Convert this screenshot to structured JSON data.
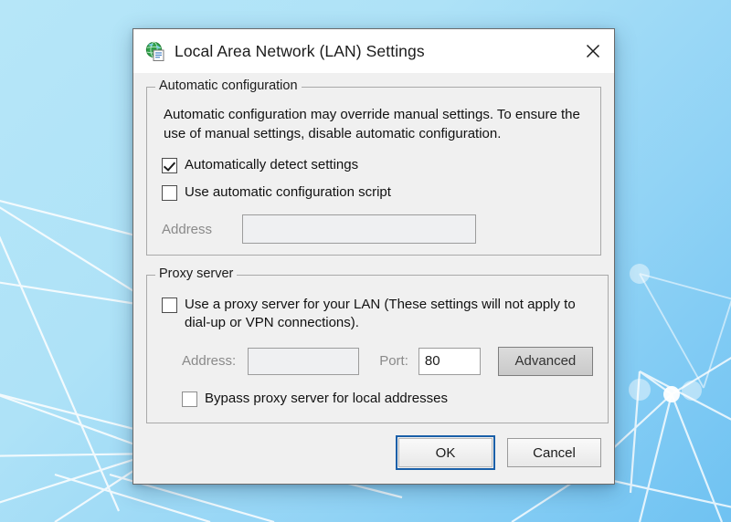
{
  "window": {
    "title": "Local Area Network (LAN) Settings",
    "icon": "globe-document-icon",
    "close_label": "close-icon"
  },
  "automatic_configuration": {
    "group_title": "Automatic configuration",
    "description": "Automatic configuration may override manual settings.  To ensure the use of manual settings, disable automatic configuration.",
    "auto_detect": {
      "label": "Automatically detect settings",
      "checked": true
    },
    "use_script": {
      "label": "Use automatic configuration script",
      "checked": false
    },
    "address": {
      "label": "Address",
      "value": "",
      "placeholder": "",
      "enabled": false
    }
  },
  "proxy_server": {
    "group_title": "Proxy server",
    "use_proxy": {
      "label": "Use a proxy server for your LAN (These settings will not apply to dial-up or VPN connections).",
      "checked": false
    },
    "address": {
      "label": "Address:",
      "value": "",
      "placeholder": "",
      "enabled": false
    },
    "port": {
      "label": "Port:",
      "value": "80",
      "placeholder": "",
      "enabled": false
    },
    "advanced_button": {
      "label": "Advanced",
      "enabled": false
    },
    "bypass": {
      "label": "Bypass proxy server for local addresses",
      "checked": false
    }
  },
  "footer": {
    "ok_label": "OK",
    "cancel_label": "Cancel"
  },
  "colors": {
    "desktop_blue": "#8fd2f5",
    "dialog_face": "#f0f0f0",
    "titlebar": "#ffffff",
    "group_border": "#a9a9a9",
    "focus_blue": "#1a5fa8",
    "disabled_text": "#8a8a8a"
  }
}
